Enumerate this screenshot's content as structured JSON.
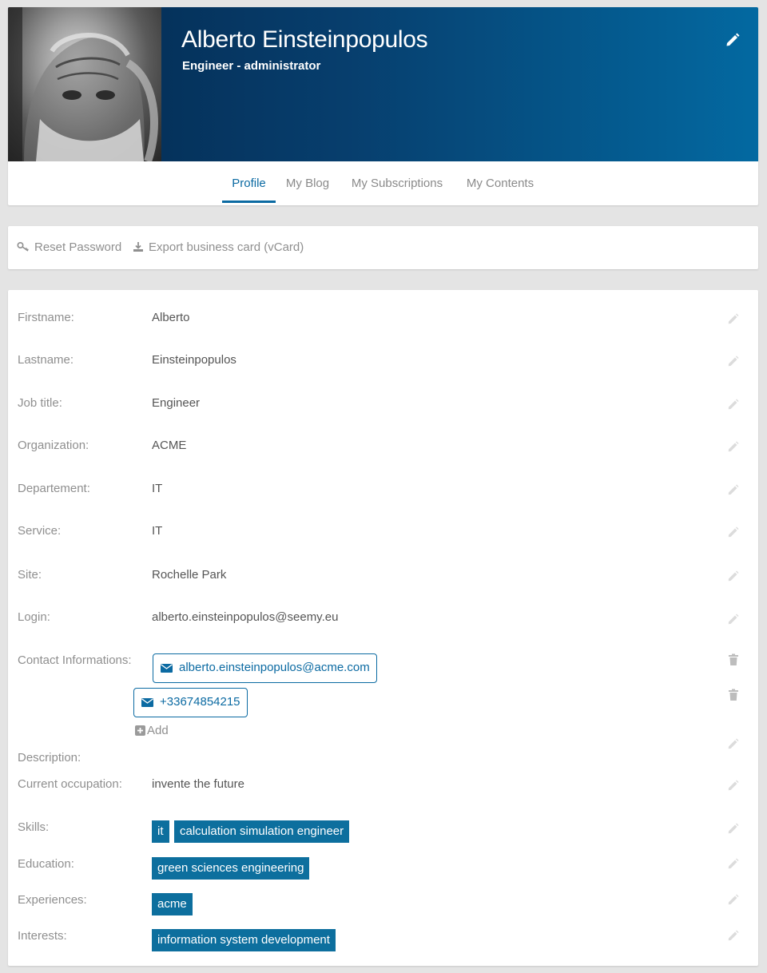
{
  "header": {
    "name": "Alberto Einsteinpopulos",
    "role": "Engineer - administrator"
  },
  "tabs": [
    {
      "label": "Profile",
      "active": true
    },
    {
      "label": "My Blog",
      "active": false
    },
    {
      "label": "My Subscriptions",
      "active": false
    },
    {
      "label": "My Contents",
      "active": false
    }
  ],
  "actions": {
    "reset_password": "Reset Password",
    "export_vcard": "Export business card (vCard)"
  },
  "fields": {
    "firstname": {
      "label": "Firstname:",
      "value": "Alberto"
    },
    "lastname": {
      "label": "Lastname:",
      "value": "Einsteinpopulos"
    },
    "job_title": {
      "label": "Job title:",
      "value": "Engineer"
    },
    "organization": {
      "label": "Organization:",
      "value": "ACME"
    },
    "department": {
      "label": "Departement:",
      "value": "IT"
    },
    "service": {
      "label": "Service:",
      "value": "IT"
    },
    "site": {
      "label": "Site:",
      "value": "Rochelle Park"
    },
    "login": {
      "label": "Login:",
      "value": "alberto.einsteinpopulos@seemy.eu"
    },
    "contact": {
      "label": "Contact Informations:",
      "items": [
        "alberto.einsteinpopulos@acme.com",
        "+33674854215"
      ],
      "add_label": "Add"
    },
    "description": {
      "label": "Description:",
      "value": ""
    },
    "occupation": {
      "label": "Current occupation:",
      "value": "invente the future"
    },
    "skills": {
      "label": "Skills:",
      "tags": [
        "it",
        "calculation simulation engineer"
      ]
    },
    "education": {
      "label": "Education:",
      "tags": [
        "green sciences engineering"
      ]
    },
    "experiences": {
      "label": "Experiences:",
      "tags": [
        "acme"
      ]
    },
    "interests": {
      "label": "Interests:",
      "tags": [
        "information system development"
      ]
    }
  },
  "colors": {
    "accent": "#0b6aa2",
    "tag_bg": "#0d6f9e",
    "banner_dark": "#03284d",
    "banner_light": "#0369a1"
  }
}
